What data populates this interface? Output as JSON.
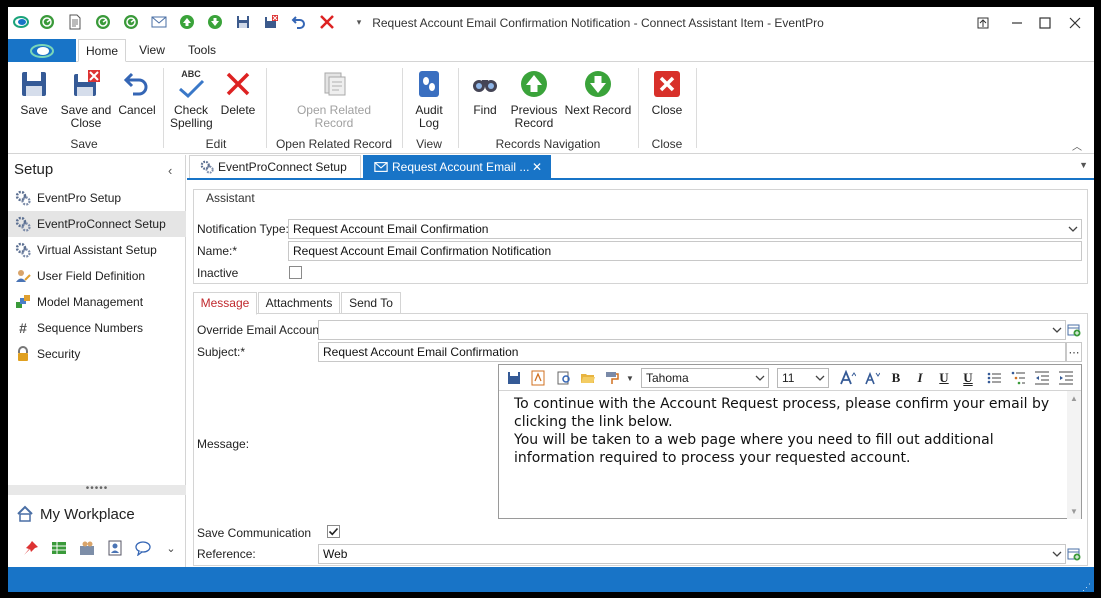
{
  "window": {
    "title": "Request Account Email Confirmation Notification - Connect Assistant Item - EventPro"
  },
  "quick_access": [
    "app-logo-icon",
    "refresh-icon",
    "document-icon",
    "refresh-icon",
    "refresh-icon",
    "mail-icon",
    "up-arrow-icon",
    "down-arrow-icon",
    "save-icon",
    "save-close-icon",
    "undo-icon",
    "delete-icon",
    "customize-icon"
  ],
  "menu": {
    "tabs": [
      "Home",
      "View",
      "Tools"
    ],
    "active": "Home"
  },
  "ribbon": {
    "save": "Save",
    "save_close_1": "Save and",
    "save_close_2": "Close",
    "cancel": "Cancel",
    "group_save": "Save",
    "check_1": "Check",
    "check_2": "Spelling",
    "delete": "Delete",
    "group_edit": "Edit",
    "open_related_1": "Open Related",
    "open_related_2": "Record",
    "group_open_related": "Open Related Record",
    "audit_1": "Audit",
    "audit_2": "Log",
    "group_view": "View",
    "find": "Find",
    "prev_1": "Previous",
    "prev_2": "Record",
    "next": "Next Record",
    "group_nav": "Records Navigation",
    "close": "Close",
    "group_close": "Close",
    "abc": "ABC"
  },
  "nav": {
    "title": "Setup",
    "items": [
      {
        "label": "EventPro Setup"
      },
      {
        "label": "EventProConnect Setup"
      },
      {
        "label": "Virtual Assistant Setup"
      },
      {
        "label": "User Field Definition"
      },
      {
        "label": "Model Management"
      },
      {
        "label": "Sequence Numbers"
      },
      {
        "label": "Security"
      }
    ],
    "selected": "EventProConnect Setup",
    "workplace": "My Workplace",
    "grip": "•••••"
  },
  "doc_tabs": [
    {
      "label": "EventProConnect Setup"
    },
    {
      "label": "Request Account Email ..."
    }
  ],
  "assistant": {
    "group_label": "Assistant",
    "notification_type_label": "Notification Type:",
    "notification_type_value": "Request Account Email Confirmation",
    "name_label": "Name:*",
    "name_value": "Request Account Email Confirmation Notification",
    "inactive_label": "Inactive",
    "inactive_checked": false
  },
  "sub_tabs": [
    "Message",
    "Attachments",
    "Send To"
  ],
  "message": {
    "override_label": "Override Email Account:",
    "override_value": "",
    "subject_label": "Subject:*",
    "subject_value": "Request Account Email Confirmation",
    "message_label": "Message:",
    "font_name": "Tahoma",
    "font_size": "11",
    "body_line1": "To continue with the Account Request process, please confirm your email by clicking the link below.",
    "body_line2": "You will be taken to a web page where you need to fill out additional information required to process your requested account.",
    "save_comm_label": "Save Communication",
    "save_comm_checked": true,
    "reference_label": "Reference:",
    "reference_value": "Web"
  },
  "colors": {
    "accent": "#1874c7",
    "active_subtab": "#c0282d"
  }
}
